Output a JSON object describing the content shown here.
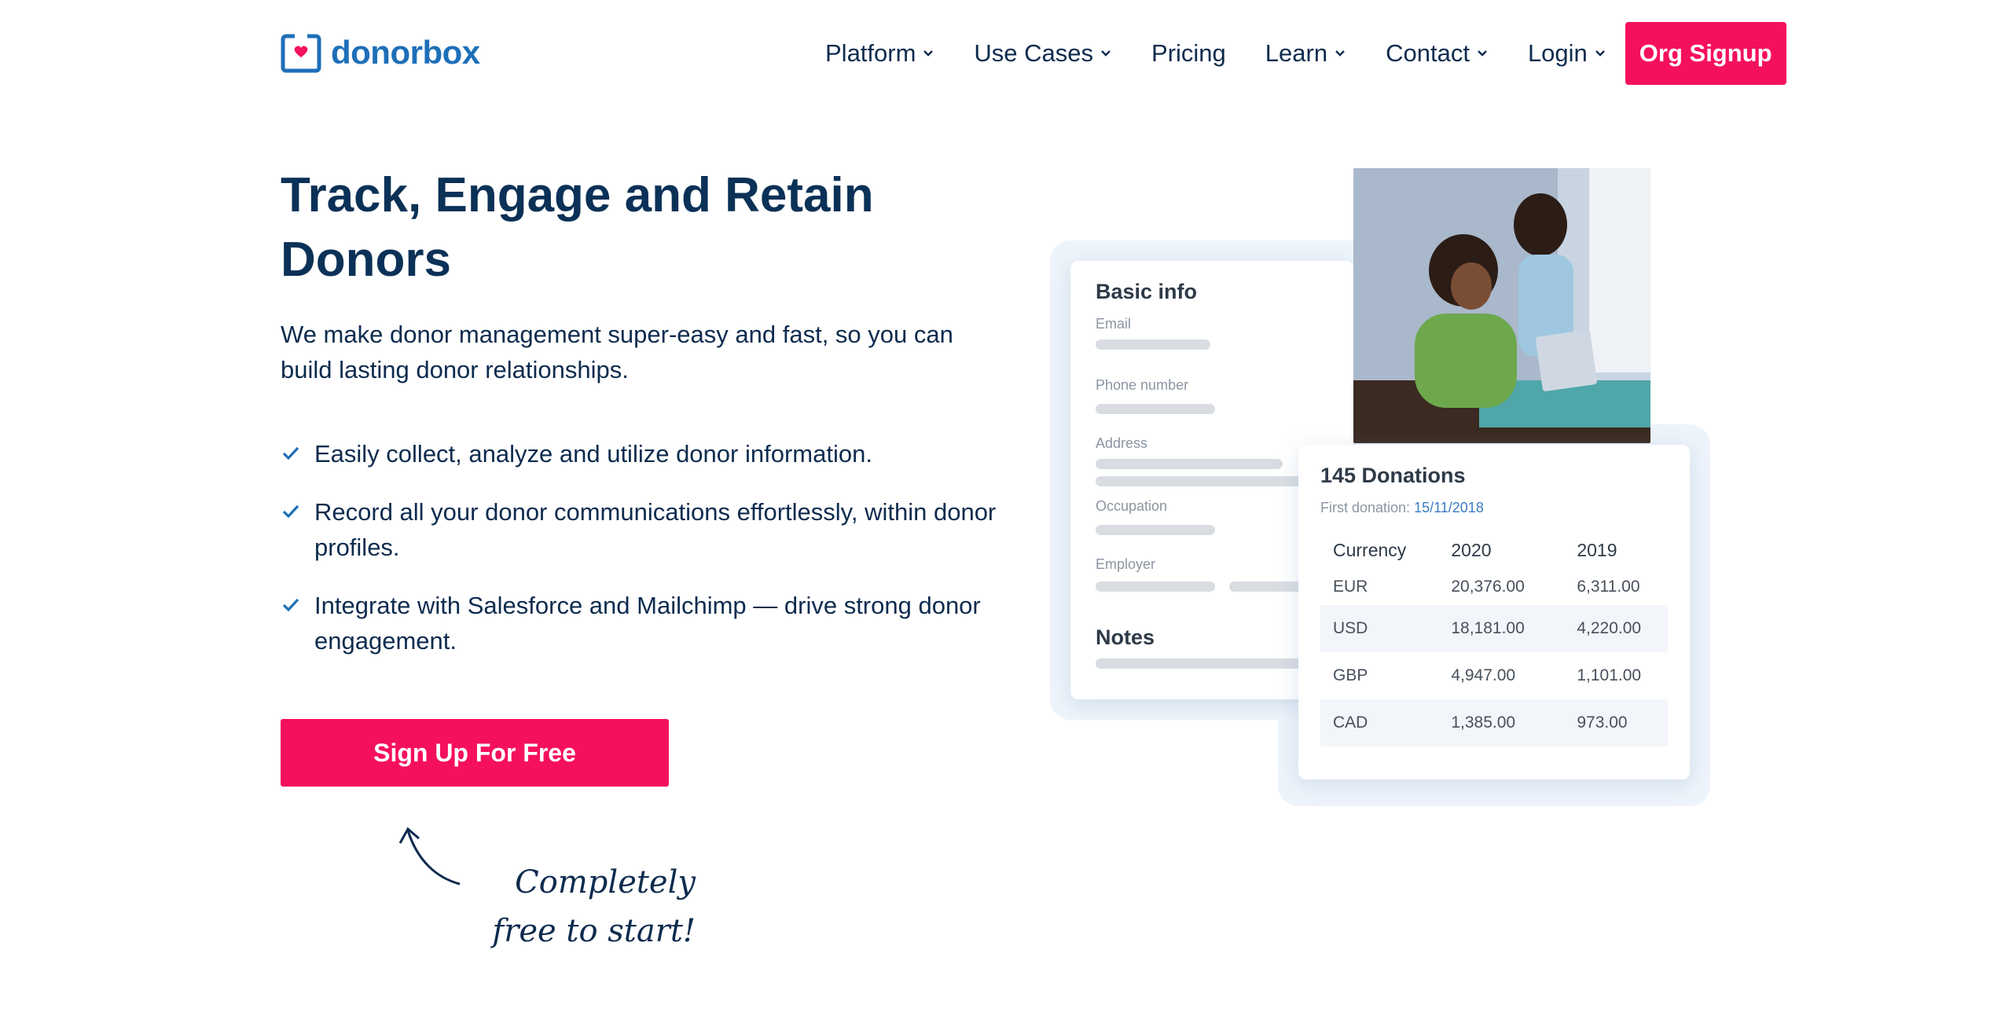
{
  "brand": {
    "name": "donorbox",
    "accent": "#f5105e",
    "logo_color": "#1e6fb8"
  },
  "nav": {
    "items": [
      {
        "label": "Platform",
        "has_dropdown": true
      },
      {
        "label": "Use Cases",
        "has_dropdown": true
      },
      {
        "label": "Pricing",
        "has_dropdown": false
      },
      {
        "label": "Learn",
        "has_dropdown": true
      },
      {
        "label": "Contact",
        "has_dropdown": true
      },
      {
        "label": "Login",
        "has_dropdown": true
      }
    ],
    "signup_label": "Org Signup"
  },
  "hero": {
    "title": "Track, Engage and Retain Donors",
    "description": "We make donor management super-easy and fast, so you can build lasting donor relationships.",
    "features": [
      "Easily collect, analyze and utilize donor information.",
      "Record all your donor communications effortlessly, within donor profiles.",
      "Integrate with Salesforce and Mailchimp — drive strong donor engagement."
    ],
    "cta_label": "Sign Up For Free",
    "note_line1": "Completely",
    "note_line2": "free to start!"
  },
  "illustration": {
    "basic_info": {
      "title": "Basic info",
      "fields": [
        "Email",
        "Phone number",
        "Address",
        "Occupation",
        "Employer"
      ],
      "notes_title": "Notes"
    },
    "donations": {
      "title": "145 Donations",
      "first_label": "First donation:",
      "first_date": "15/11/2018",
      "columns": [
        "Currency",
        "2020",
        "2019"
      ],
      "rows": [
        [
          "EUR",
          "20,376.00",
          "6,311.00"
        ],
        [
          "USD",
          "18,181.00",
          "4,220.00"
        ],
        [
          "GBP",
          "4,947.00",
          "1,101.00"
        ],
        [
          "CAD",
          "1,385.00",
          "973.00"
        ]
      ]
    }
  }
}
